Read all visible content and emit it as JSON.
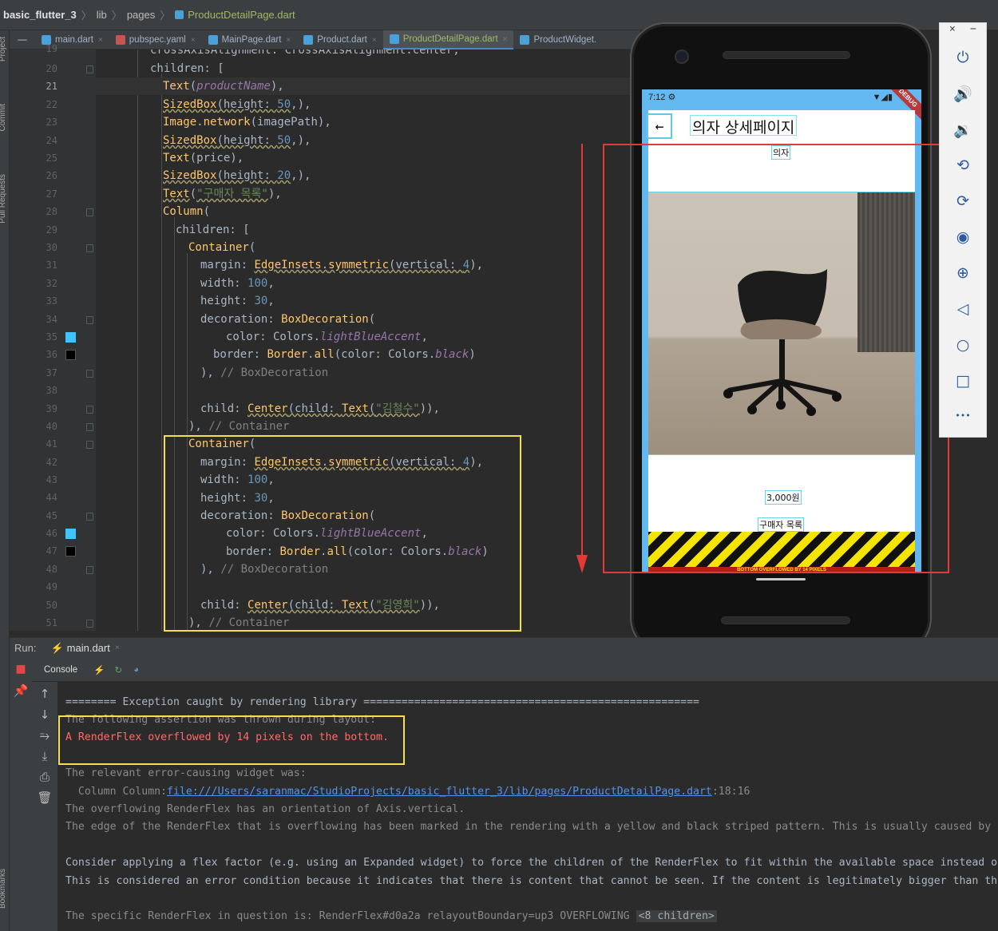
{
  "breadcrumb": {
    "project": "basic_flutter_3",
    "dir1": "lib",
    "dir2": "pages",
    "file": "ProductDetailPage.dart"
  },
  "left_tabs": {
    "project": "Project",
    "commit": "Commit",
    "pull_requests": "Pull Requests",
    "bookmarks": "Bookmarks"
  },
  "tabs": [
    {
      "label": "main.dart",
      "close": "×"
    },
    {
      "label": "pubspec.yaml",
      "close": "×"
    },
    {
      "label": "MainPage.dart",
      "close": "×"
    },
    {
      "label": "Product.dart",
      "close": "×"
    },
    {
      "label": "ProductDetailPage.dart",
      "close": "×"
    },
    {
      "label": "ProductWidget.",
      "close": ""
    }
  ],
  "line_numbers": [
    "19",
    "20",
    "21",
    "22",
    "23",
    "24",
    "25",
    "26",
    "27",
    "28",
    "29",
    "30",
    "31",
    "32",
    "33",
    "34",
    "35",
    "36",
    "37",
    "38",
    "39",
    "40",
    "41",
    "42",
    "43",
    "44",
    "45",
    "46",
    "47",
    "48",
    "49",
    "50",
    "51"
  ],
  "code": {
    "l19": "crossAxisAlignment: CrossAxisAlignment.center,",
    "l20a": "children: [",
    "l21": [
      "Text",
      "(",
      "productName",
      "),"
    ],
    "l22": [
      "SizedBox",
      "(height: ",
      "50",
      ",),"
    ],
    "l23": [
      "Image",
      ".",
      "network",
      "(imagePath),"
    ],
    "l24": [
      "SizedBox",
      "(height: ",
      "50",
      ",),"
    ],
    "l25": [
      "Text",
      "(price),"
    ],
    "l26": [
      "SizedBox",
      "(height: ",
      "20",
      ",),"
    ],
    "l27": [
      "Text",
      "(",
      "\"구매자 목록\"",
      "),"
    ],
    "l28": [
      "Column",
      "("
    ],
    "l29": "children: [",
    "l30": [
      "Container",
      "("
    ],
    "l31": [
      "margin: ",
      "EdgeInsets",
      ".",
      "symmetric",
      "(vertical: ",
      "4",
      "),"
    ],
    "l32": [
      "width: ",
      "100",
      ","
    ],
    "l33": [
      "height: ",
      "30",
      ","
    ],
    "l34": [
      "decoration: ",
      "BoxDecoration",
      "("
    ],
    "l35": [
      "color: Colors.",
      "lightBlueAccent",
      ","
    ],
    "l36": [
      "border: ",
      "Border",
      ".",
      "all",
      "(color: Colors.",
      "black",
      ")"
    ],
    "l37": [
      "), ",
      "// BoxDecoration"
    ],
    "l39": [
      "child: ",
      "Center",
      "(child: ",
      "Text",
      "(",
      "\"김철수\"",
      ")),"
    ],
    "l40": [
      "), ",
      "// Container"
    ],
    "l41": [
      "Container",
      "("
    ],
    "l42": [
      "margin: ",
      "EdgeInsets",
      ".",
      "symmetric",
      "(vertical: ",
      "4",
      "),"
    ],
    "l43": [
      "width: ",
      "100",
      ","
    ],
    "l44": [
      "height: ",
      "30",
      ","
    ],
    "l45": [
      "decoration: ",
      "BoxDecoration",
      "("
    ],
    "l46": [
      "color: Colors.",
      "lightBlueAccent",
      ","
    ],
    "l47": [
      "border: ",
      "Border",
      ".",
      "all",
      "(color: Colors.",
      "black",
      ")"
    ],
    "l48": [
      "), ",
      "// BoxDecoration"
    ],
    "l50": [
      "child: ",
      "Center",
      "(child: ",
      "Text",
      "(",
      "\"김영희\"",
      ")),"
    ],
    "l51": [
      "), ",
      "// Container"
    ]
  },
  "swatches": {
    "light_blue": "#40c4ff",
    "black": "#000000"
  },
  "phone": {
    "status_time": "7:12",
    "debug_banner": "DEBUG",
    "app_title": "의자 상세페이지",
    "product_name": "의자",
    "price": "3,000원",
    "buyers_label": "구매자 목록",
    "overflow_label": "BOTTOM OVERFLOWED BY 14 PIXELS"
  },
  "emulator_toolbar": {
    "close": "×",
    "minimize": "−",
    "more": "•••"
  },
  "run": {
    "label": "Run:",
    "config": "main.dart",
    "close": "×",
    "console_tab": "Console"
  },
  "console": {
    "l1": "======== Exception caught by rendering library =====================================================",
    "l2": "The following assertion was thrown during layout:",
    "l3": "A RenderFlex overflowed by 14 pixels on the bottom.",
    "l4": "The relevant error-causing widget was:",
    "l5_prefix": "  Column Column:",
    "l5_link": "file:///Users/saranmac/StudioProjects/basic_flutter_3/lib/pages/ProductDetailPage.dart",
    "l5_suffix": ":18:16",
    "l6": "The overflowing RenderFlex has an orientation of Axis.vertical.",
    "l7": "The edge of the RenderFlex that is overflowing has been marked in the rendering with a yellow and black striped pattern. This is usually caused by",
    "l8": "Consider applying a flex factor (e.g. using an Expanded widget) to force the children of the RenderFlex to fit within the available space instead o",
    "l9": "This is considered an error condition because it indicates that there is content that cannot be seen. If the content is legitimately bigger than th",
    "l10": "The specific RenderFlex in question is: RenderFlex#d0a2a relayoutBoundary=up3 OVERFLOWING",
    "l10_badge": "<8 children>"
  },
  "colors": {
    "highlight_yellow": "#f4e04d",
    "highlight_red": "#e53935",
    "error_red": "#ff6b68",
    "overflow_stripe": "#f5e400"
  }
}
